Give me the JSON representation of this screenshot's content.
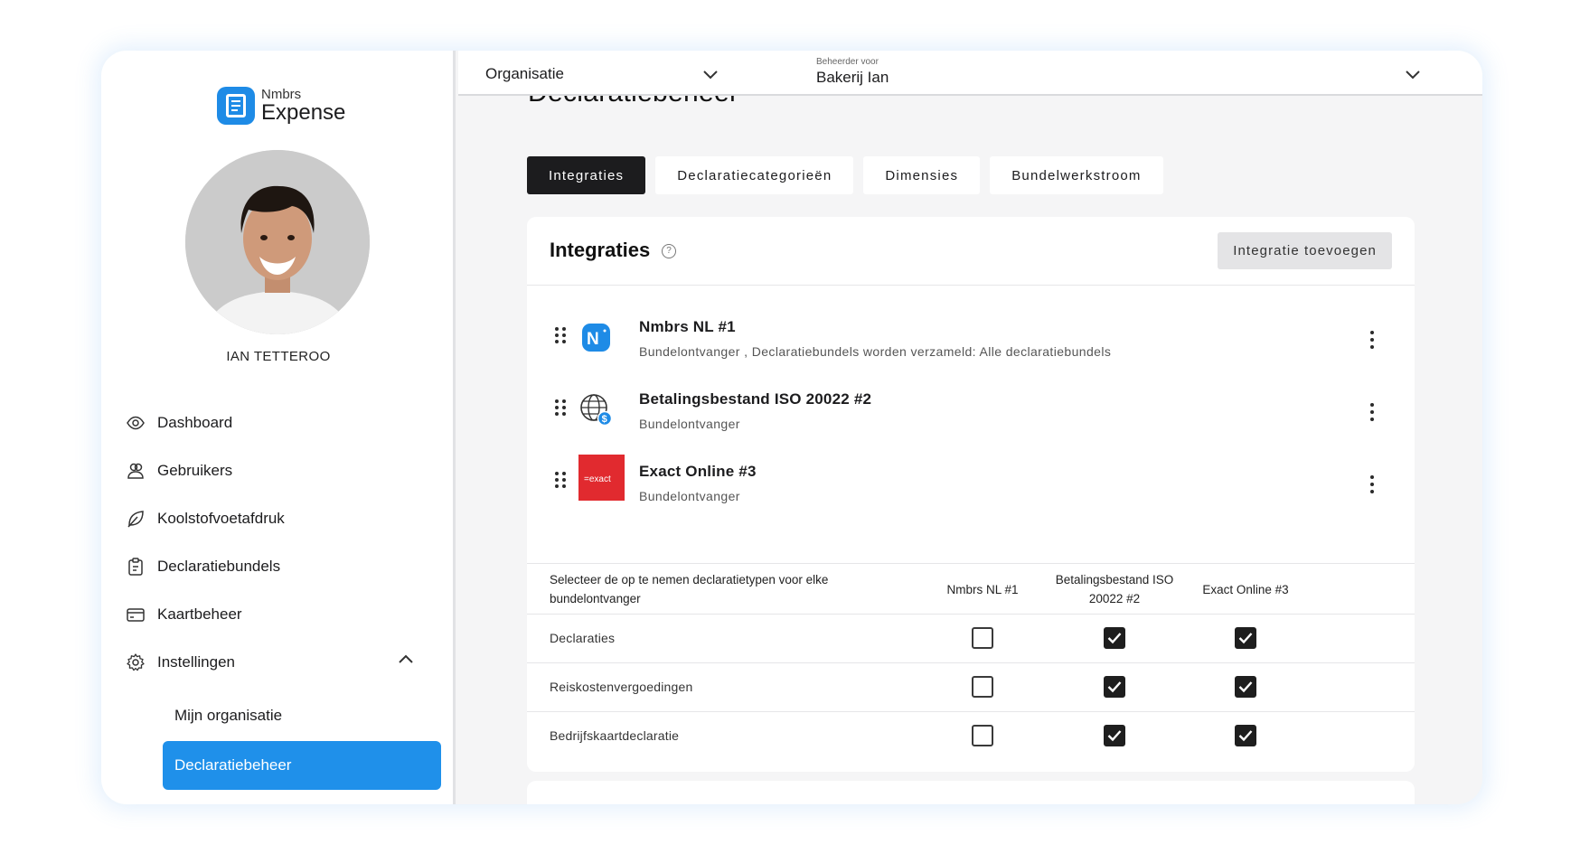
{
  "app": {
    "logo_small": "Nmbrs",
    "logo_big": "Expense",
    "accent": "#1f90ea"
  },
  "user": {
    "name": "IAN TETTEROO"
  },
  "sidebar": {
    "items": [
      {
        "label": "Dashboard",
        "icon": "eye-icon"
      },
      {
        "label": "Gebruikers",
        "icon": "users-icon"
      },
      {
        "label": "Koolstofvoetafdruk",
        "icon": "leaf-icon"
      },
      {
        "label": "Declaratiebundels",
        "icon": "clipboard-icon"
      },
      {
        "label": "Kaartbeheer",
        "icon": "card-icon"
      },
      {
        "label": "Instellingen",
        "icon": "gear-icon",
        "expanded": true
      }
    ],
    "subitems": [
      {
        "label": "Mijn organisatie",
        "active": false
      },
      {
        "label": "Declaratiebeheer",
        "active": true
      }
    ]
  },
  "topbar": {
    "organisation_label": "Organisatie",
    "beheerder_label": "Beheerder voor",
    "beheerder_value": "Bakerij Ian"
  },
  "page": {
    "title": "Declaratiebeheer",
    "tabs": [
      {
        "label": "Integraties",
        "active": true
      },
      {
        "label": "Declaratiecategorieën",
        "active": false
      },
      {
        "label": "Dimensies",
        "active": false
      },
      {
        "label": "Bundelwerkstroom",
        "active": false
      }
    ]
  },
  "integrations": {
    "title": "Integraties",
    "add_button": "Integratie toevoegen",
    "items": [
      {
        "name": "Nmbrs NL #1",
        "desc": "Bundelontvanger , Declaratiebundels worden verzameld: Alle declaratiebundels",
        "logo": "nmbrs-logo",
        "logo_text": "N"
      },
      {
        "name": "Betalingsbestand ISO 20022 #2",
        "desc": "Bundelontvanger",
        "logo": "globe-dollar-icon"
      },
      {
        "name": "Exact Online #3",
        "desc": "Bundelontvanger",
        "logo": "exact-logo",
        "logo_text": "=exact"
      }
    ]
  },
  "table": {
    "header": "Selecteer de op te nemen declaratietypen voor elke bundelontvanger",
    "columns": [
      "Nmbrs NL #1",
      "Betalingsbestand ISO 20022 #2",
      "Exact Online #3"
    ],
    "rows": [
      {
        "label": "Declaraties",
        "checked": [
          false,
          true,
          true
        ]
      },
      {
        "label": "Reiskostenvergoedingen",
        "checked": [
          false,
          true,
          true
        ]
      },
      {
        "label": "Bedrijfskaartdeclaratie",
        "checked": [
          false,
          true,
          true
        ]
      }
    ]
  }
}
